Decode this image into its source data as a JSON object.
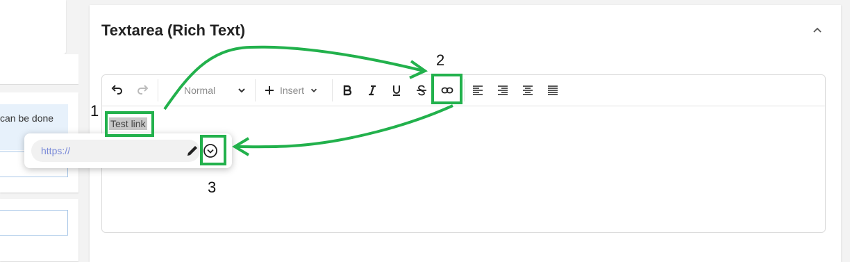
{
  "left": {
    "info_text": "can be done"
  },
  "panel": {
    "title": "Textarea (Rich Text)"
  },
  "toolbar": {
    "format_select": "Normal",
    "insert_label": "Insert",
    "buttons": [
      "undo-icon",
      "redo-icon",
      "bold-icon",
      "italic-icon",
      "underline-icon",
      "strikethrough-icon",
      "link-icon",
      "align-left-icon",
      "align-right-icon",
      "align-center-icon",
      "align-justify-icon"
    ]
  },
  "editor": {
    "selected_text": "Test link"
  },
  "link_popup": {
    "placeholder": "https://"
  },
  "annotations": {
    "step1": "1",
    "step2": "2",
    "step3": "3",
    "color": "#22b14c"
  }
}
